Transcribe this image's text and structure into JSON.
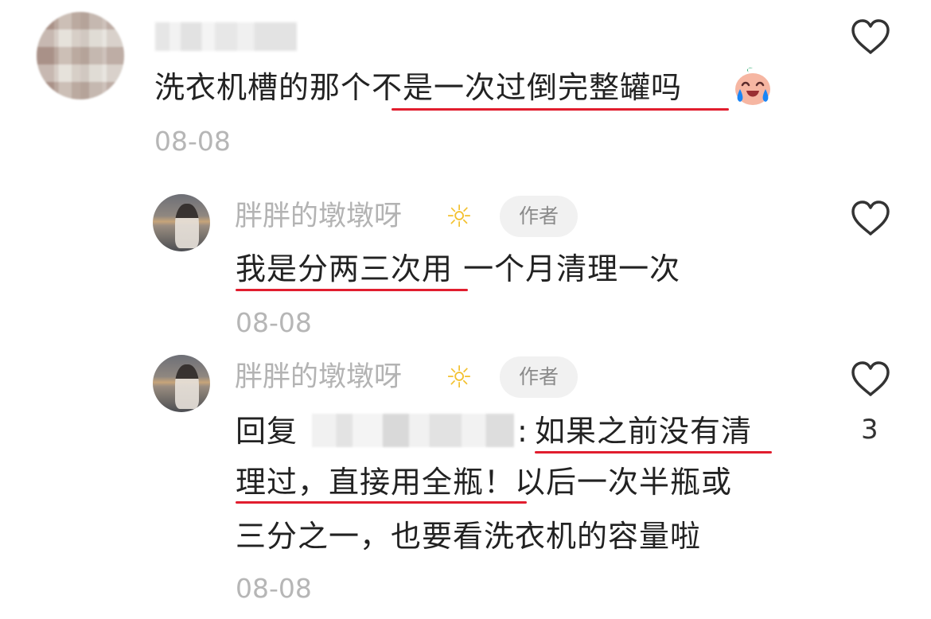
{
  "comments": [
    {
      "user": {
        "avatar": "blurred-avatar",
        "name": "",
        "name_blurred": true
      },
      "text_line1_prefix": "洗衣机槽的那个",
      "text_line1_highlight": "不是一次过倒完整罐吗",
      "emoji": "crying-laughing-face",
      "date": "08-08",
      "likes": {
        "icon": "heart-outline-icon",
        "count": ""
      }
    },
    {
      "user": {
        "avatar": "photo-avatar",
        "name": "胖胖的墩墩呀",
        "badge": "作者",
        "badge_icon": "sun-icon"
      },
      "text_highlight": "我是分两三次用",
      "text_rest": " 一个月清理一次",
      "date": "08-08",
      "likes": {
        "icon": "heart-outline-icon",
        "count": ""
      }
    },
    {
      "user": {
        "avatar": "photo-avatar",
        "name": "胖胖的墩墩呀",
        "badge": "作者",
        "badge_icon": "sun-icon"
      },
      "reply_prefix": "回复",
      "reply_colon": ":",
      "line1_highlight": "如果之前没有清",
      "line2_highlight": "理过，直接用全瓶！",
      "line2_rest": "以后一次半瓶或",
      "line3": "三分之一，也要看洗衣机的容量啦",
      "date": "08-08",
      "likes": {
        "icon": "heart-outline-icon",
        "count": "3"
      }
    }
  ],
  "colors": {
    "text": "#222222",
    "muted": "#b6b6b6",
    "highlight": "#e11d2e",
    "badge_bg": "#f1f1f1"
  }
}
